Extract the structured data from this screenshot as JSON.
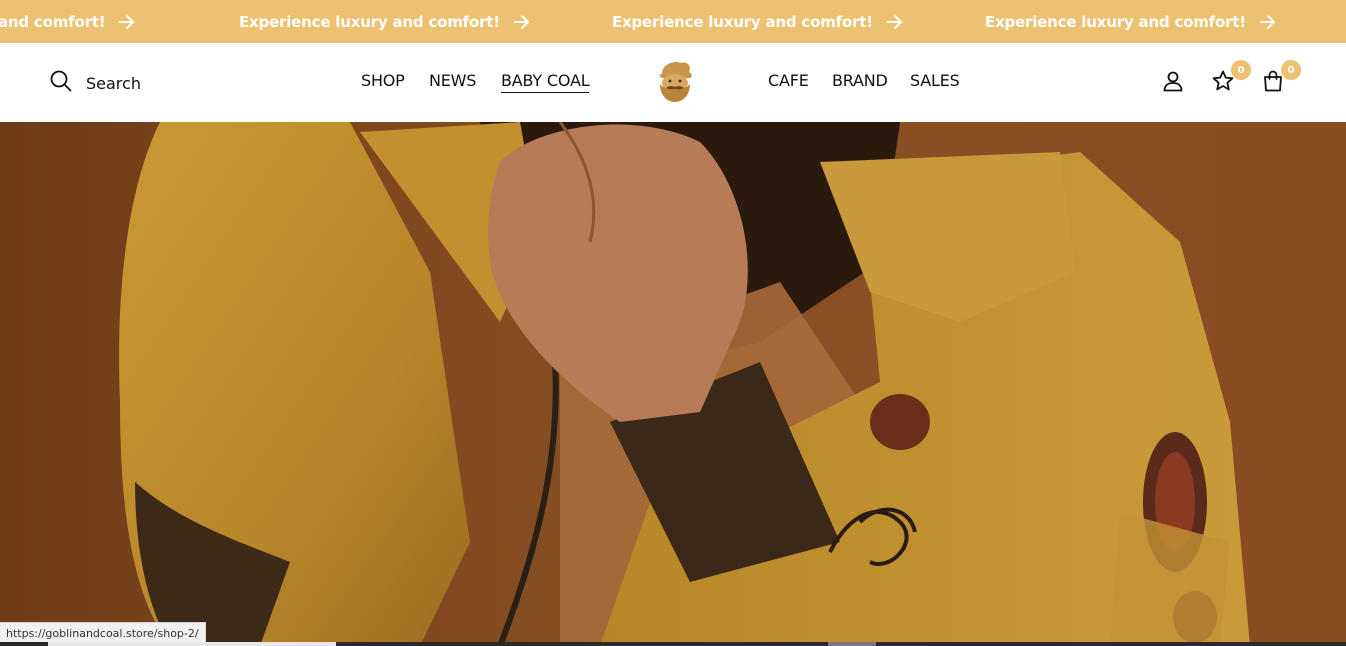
{
  "announcement": {
    "items": [
      "and comfort!",
      "Experience luxury and comfort!",
      "Experience luxury and comfort!",
      "Experience luxury and comfort!"
    ],
    "background_color": "#ecc172",
    "text_color": "#ffffff",
    "icon": "arrow-right-icon"
  },
  "header": {
    "search": {
      "label": "Search",
      "icon": "search-icon"
    },
    "nav_left": [
      {
        "label": "SHOP"
      },
      {
        "label": "NEWS"
      },
      {
        "label": "BABY COAL",
        "active": true
      }
    ],
    "logo": {
      "icon": "bearded-face-logo",
      "color": "#c8954a"
    },
    "nav_right": [
      {
        "label": "CAFE"
      },
      {
        "label": "BRAND"
      },
      {
        "label": "SALES"
      }
    ],
    "actions": {
      "account_icon": "user-icon",
      "wishlist_icon": "star-icon",
      "wishlist_count": "0",
      "cart_icon": "shopping-bag-icon",
      "cart_count": "0"
    }
  },
  "hero": {
    "image": "man-in-mustard-jacket-photo",
    "background_color": "#82461d",
    "jacket_color": "#c28f2a"
  },
  "browser": {
    "status_url": "https://goblinandcoal.store/shop-2/"
  }
}
